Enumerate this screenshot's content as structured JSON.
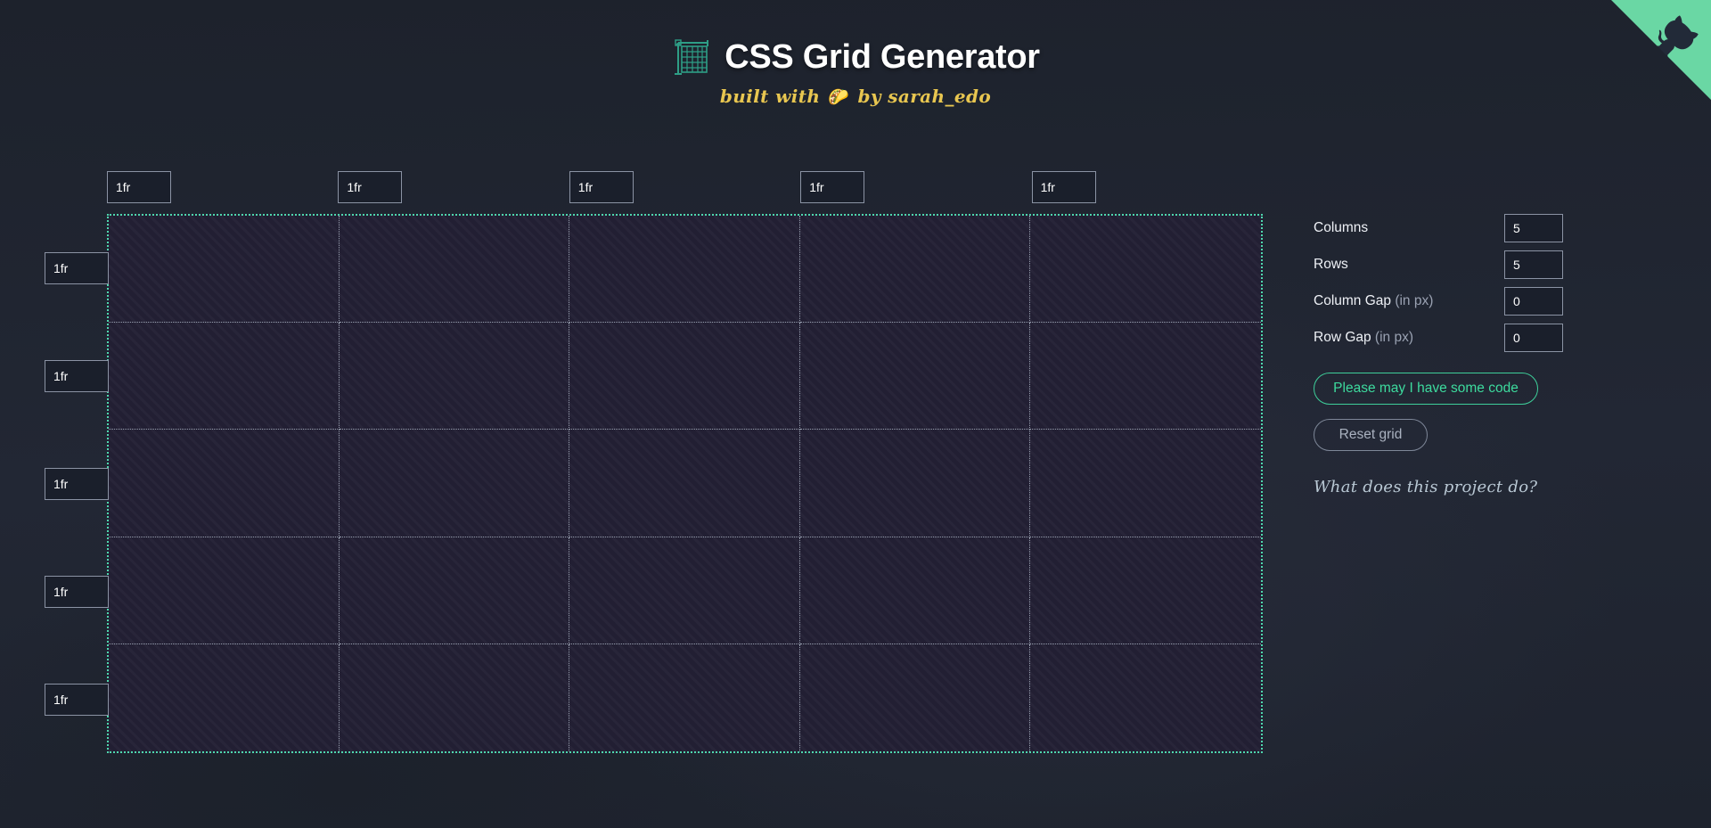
{
  "header": {
    "icon": "abacus-grid-icon",
    "title": "CSS Grid Generator",
    "subtitle_prefix": "built with",
    "subtitle_emoji": "🌮",
    "subtitle_suffix": "by sarah_edo"
  },
  "github_corner": {
    "label": "fork-me-on-github",
    "ribbon_color": "#6ad7a4",
    "octocat_color": "#222a38"
  },
  "grid": {
    "columns": 5,
    "rows": 5,
    "column_sizes": [
      "1fr",
      "1fr",
      "1fr",
      "1fr",
      "1fr"
    ],
    "row_sizes": [
      "1fr",
      "1fr",
      "1fr",
      "1fr",
      "1fr"
    ],
    "border_color": "#4ed8ad",
    "cell_divider_color": "#9aa2b2",
    "cell_fill": "#221f33"
  },
  "controls": {
    "rows": [
      {
        "label": "Columns",
        "unit": "",
        "value": "5",
        "name": "columns"
      },
      {
        "label": "Rows",
        "unit": "",
        "value": "5",
        "name": "rows"
      },
      {
        "label": "Column Gap",
        "unit": " (in px)",
        "value": "0",
        "name": "column-gap"
      },
      {
        "label": "Row Gap",
        "unit": " (in px)",
        "value": "0",
        "name": "row-gap"
      }
    ],
    "generate_button": "Please may I have some code",
    "reset_button": "Reset grid",
    "help_link": "What does this project do?",
    "accent_color": "#3ddb9e",
    "muted_color": "#aab2c0"
  }
}
